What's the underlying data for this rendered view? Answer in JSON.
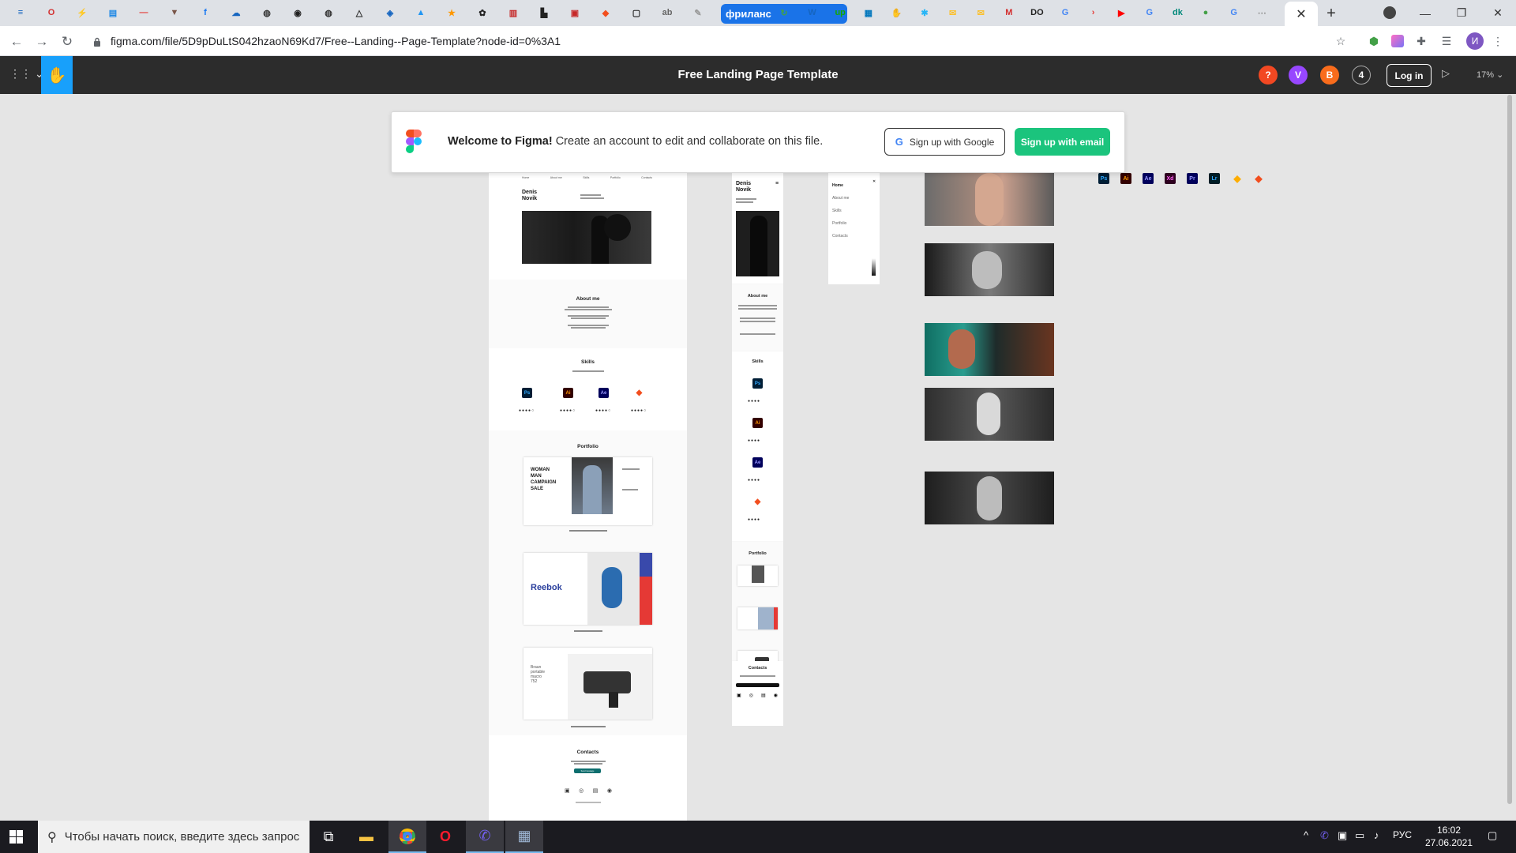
{
  "browser": {
    "pinned_tabs": [
      {
        "icon": "menu-icon",
        "glyph": "≡",
        "color": "#1565c0"
      },
      {
        "icon": "opera-icon",
        "glyph": "O",
        "color": "#d32f2f"
      },
      {
        "icon": "bolt-icon",
        "glyph": "⚡",
        "color": "#f9a825"
      },
      {
        "icon": "chart-icon",
        "glyph": "▤",
        "color": "#1e88e5"
      },
      {
        "icon": "dash-icon",
        "glyph": "—",
        "color": "#e53935"
      },
      {
        "icon": "fox-icon",
        "glyph": "▼",
        "color": "#795548"
      },
      {
        "icon": "facebook-icon",
        "glyph": "f",
        "color": "#1877f2"
      },
      {
        "icon": "cloud-icon",
        "glyph": "☁",
        "color": "#1565c0"
      },
      {
        "icon": "globe-icon",
        "glyph": "◍",
        "color": "#333"
      },
      {
        "icon": "github-icon",
        "glyph": "◉",
        "color": "#222"
      },
      {
        "icon": "globe-icon",
        "glyph": "◍",
        "color": "#333"
      },
      {
        "icon": "triangle-icon",
        "glyph": "△",
        "color": "#333"
      },
      {
        "icon": "shield-icon",
        "glyph": "◈",
        "color": "#1565c0"
      },
      {
        "icon": "image-icon",
        "glyph": "▲",
        "color": "#2196f3"
      },
      {
        "icon": "star-icon",
        "glyph": "★",
        "color": "#ff9800"
      },
      {
        "icon": "settings-icon",
        "glyph": "✿",
        "color": "#222"
      },
      {
        "icon": "pause-icon",
        "glyph": "▥",
        "color": "#c62828"
      },
      {
        "icon": "bookmark-icon",
        "glyph": "▙",
        "color": "#222"
      },
      {
        "icon": "box-icon",
        "glyph": "▣",
        "color": "#c62828"
      },
      {
        "icon": "figma-icon",
        "glyph": "◆",
        "color": "#f24e1e"
      },
      {
        "icon": "chat-icon",
        "glyph": "▢",
        "color": "#222"
      },
      {
        "icon": "text-icon",
        "glyph": "ab",
        "color": "#666"
      },
      {
        "icon": "pin-icon",
        "glyph": "✎",
        "color": "#999"
      }
    ],
    "special_tab_label": "фриланс",
    "after_tabs": [
      {
        "icon": "upwork-icon",
        "glyph": "↻",
        "color": "#43a047"
      },
      {
        "icon": "word-icon",
        "glyph": "W",
        "color": "#1565c0"
      },
      {
        "icon": "up-icon",
        "glyph": "up",
        "color": "#14a800"
      },
      {
        "icon": "trello-icon",
        "glyph": "▦",
        "color": "#0277bd"
      },
      {
        "icon": "hand-icon",
        "glyph": "✋",
        "color": "#ff8f00"
      },
      {
        "icon": "snow-icon",
        "glyph": "✱",
        "color": "#29b6f6"
      },
      {
        "icon": "mail-icon",
        "glyph": "✉",
        "color": "#fbc02d"
      },
      {
        "icon": "mail-icon",
        "glyph": "✉",
        "color": "#fbc02d"
      },
      {
        "icon": "gmail-icon",
        "glyph": "M",
        "color": "#d32f2f"
      },
      {
        "icon": "do-icon",
        "glyph": "DO",
        "color": "#222"
      },
      {
        "icon": "google-icon",
        "glyph": "G",
        "color": "#4285f4"
      },
      {
        "icon": "arrow-icon",
        "glyph": "›",
        "color": "#e53935"
      },
      {
        "icon": "youtube-icon",
        "glyph": "▶",
        "color": "#ff0000"
      },
      {
        "icon": "google-icon",
        "glyph": "G",
        "color": "#4285f4"
      },
      {
        "icon": "dk-icon",
        "glyph": "dk",
        "color": "#00897b"
      },
      {
        "icon": "leaf-icon",
        "glyph": "●",
        "color": "#43a047"
      },
      {
        "icon": "google-icon",
        "glyph": "G",
        "color": "#4285f4"
      },
      {
        "icon": "dots-icon",
        "glyph": "⋯",
        "color": "#999"
      }
    ],
    "url": "figma.com/file/5D9pDuLtS042hzaoN69Kd7/Free--Landing--Page-Template?node-id=0%3A1",
    "profile_initial": "И"
  },
  "figma": {
    "title": "Free Landing Page Template",
    "avatars": [
      {
        "label": "?",
        "color": "#f24822"
      },
      {
        "label": "V",
        "color": "#9747ff"
      },
      {
        "label": "B",
        "color": "#f96c1c"
      },
      {
        "label": "4",
        "color": "#2c2c2c"
      }
    ],
    "login_label": "Log in",
    "zoom": "17%"
  },
  "banner": {
    "bold": "Welcome to Figma!",
    "text": " Create an account to edit and collaborate on this file.",
    "google_button": "Sign up with Google",
    "email_button": "Sign up with email"
  },
  "desktop_frame": {
    "nav": [
      "Home",
      "About me",
      "Skills",
      "Portfolio",
      "Contacts"
    ],
    "name_line1": "Denis",
    "name_line2": "Novik",
    "about_title": "About me",
    "skills_title": "Skills",
    "skills": [
      {
        "label": "Ps",
        "bg": "#001e36",
        "fg": "#31a8ff"
      },
      {
        "label": "Ai",
        "bg": "#330000",
        "fg": "#ff9a00"
      },
      {
        "label": "Ae",
        "bg": "#00005b",
        "fg": "#9999ff"
      },
      {
        "label": "",
        "bg": "#ffffff",
        "fg": "#f24e1e"
      }
    ],
    "portfolio_title": "Portfolio",
    "card1_text": "WOMAN MAN CAMPAIGN SALE",
    "card1_caption": "Online fashion store - Homepage",
    "card2_brand": "Reebok",
    "card2_caption": "Reebok Store - Concept",
    "card3_text": "Braun portable macro 752",
    "card3_caption": "Braun Landing Page - Concept",
    "contacts_title": "Contacts",
    "contacts_button": "Send message"
  },
  "mobile_frame": {
    "name_line1": "Denis",
    "name_line2": "Novik",
    "about_title": "About me",
    "skills_title": "Skills",
    "portfolio_title": "Portfolio",
    "contacts_title": "Contacts"
  },
  "menu_frame": {
    "items": [
      "Home",
      "About me",
      "Skills",
      "Portfolio",
      "Contacts"
    ]
  },
  "app_icons": [
    {
      "label": "Ps",
      "bg": "#001e36",
      "fg": "#31a8ff"
    },
    {
      "label": "Ai",
      "bg": "#330000",
      "fg": "#ff9a00"
    },
    {
      "label": "Ae",
      "bg": "#00005b",
      "fg": "#9999ff"
    },
    {
      "label": "Xd",
      "bg": "#2e001f",
      "fg": "#ff61f6"
    },
    {
      "label": "Pr",
      "bg": "#00005b",
      "fg": "#9999ff"
    },
    {
      "label": "Lr",
      "bg": "#001d26",
      "fg": "#31a8ff"
    },
    {
      "label": "",
      "bg": "transparent",
      "fg": "#fdad00"
    },
    {
      "label": "",
      "bg": "transparent",
      "fg": "#f24e1e"
    }
  ],
  "taskbar": {
    "search_placeholder": "Чтобы начать поиск, введите здесь запрос",
    "language": "РУС",
    "time": "16:02",
    "date": "27.06.2021"
  }
}
